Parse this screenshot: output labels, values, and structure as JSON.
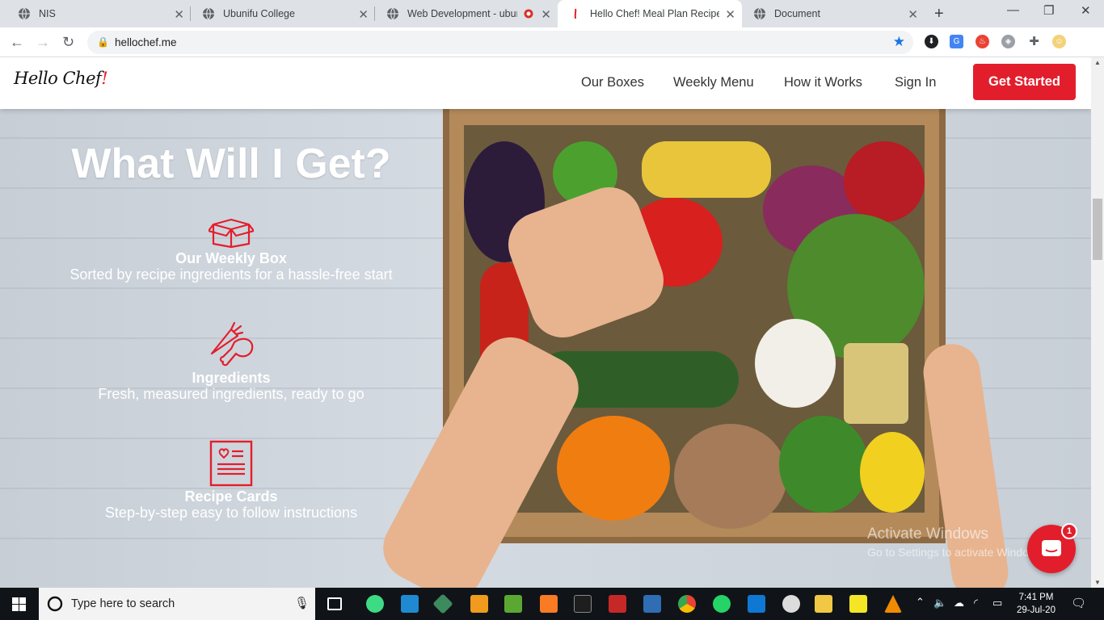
{
  "browser": {
    "tabs": [
      {
        "title": "NIS"
      },
      {
        "title": "Ubunifu College"
      },
      {
        "title": "Web Development - ubun"
      },
      {
        "title": "Hello Chef! Meal Plan Recipes |"
      },
      {
        "title": "Document"
      }
    ],
    "url": "hellochef.me"
  },
  "site": {
    "logo": "Hello Chef",
    "nav": [
      "Our Boxes",
      "Weekly Menu",
      "How it Works",
      "Sign In"
    ],
    "cta": "Get Started"
  },
  "hero": {
    "title": "What Will I Get?",
    "features": [
      {
        "name": "Our Weekly Box",
        "desc": "Sorted by recipe ingredients for a hassle-free start",
        "icon": "box-icon"
      },
      {
        "name": "Ingredients",
        "desc": "Fresh, measured ingredients, ready to go",
        "icon": "carrot-chicken-icon"
      },
      {
        "name": "Recipe Cards",
        "desc": "Step-by-step easy to follow instructions",
        "icon": "recipe-card-icon"
      }
    ]
  },
  "watermark": {
    "line1": "Activate Windows",
    "line2": "Go to Settings to activate Windows."
  },
  "chat": {
    "badge": "1"
  },
  "taskbar": {
    "search_placeholder": "Type here to search",
    "time": "7:41 PM",
    "date": "29-Jul-20"
  },
  "colors": {
    "brand_red": "#e31e2c",
    "accent_blue": "#1a73e8"
  }
}
